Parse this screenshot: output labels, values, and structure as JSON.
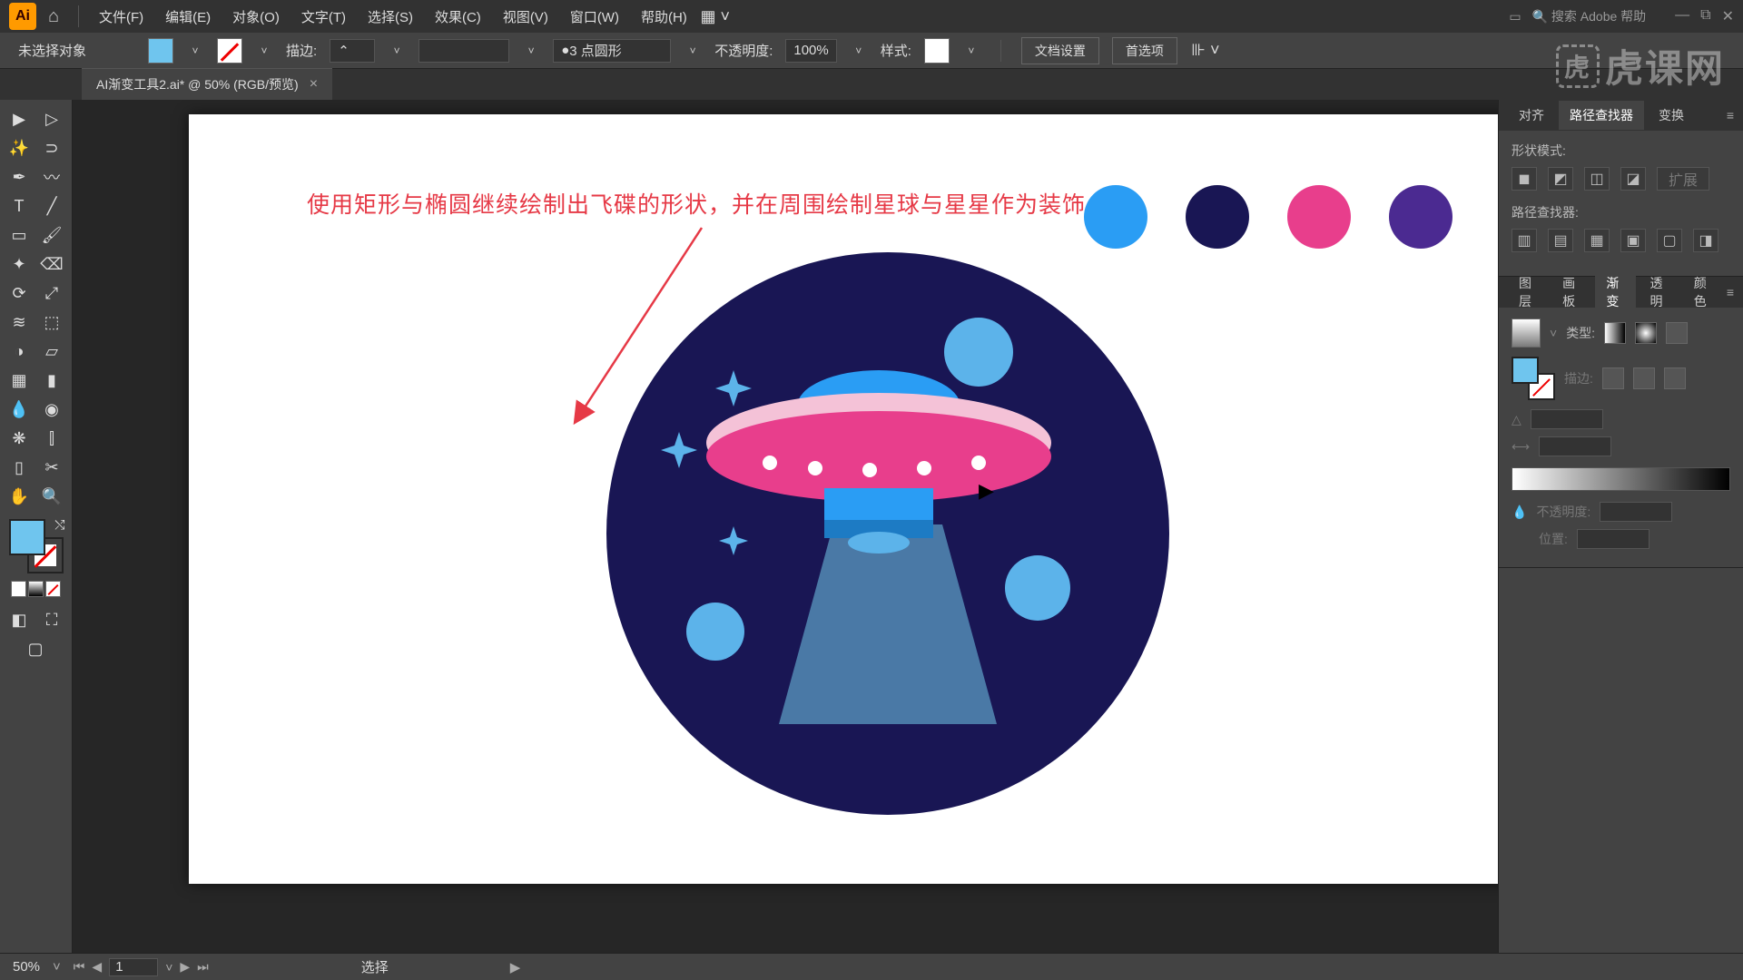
{
  "menubar": {
    "items": [
      "文件(F)",
      "编辑(E)",
      "对象(O)",
      "文字(T)",
      "选择(S)",
      "效果(C)",
      "视图(V)",
      "窗口(W)",
      "帮助(H)"
    ],
    "search_placeholder": "搜索 Adobe 帮助"
  },
  "options": {
    "status_text": "未选择对象",
    "fill_color": "#6fc5ee",
    "stroke_label": "描边:",
    "stroke_profile": "3 点圆形",
    "opacity_label": "不透明度:",
    "opacity_value": "100%",
    "style_label": "样式:",
    "doc_setup_btn": "文档设置",
    "prefs_btn": "首选项"
  },
  "doc_tab": {
    "title": "AI渐变工具2.ai* @ 50% (RGB/预览)"
  },
  "canvas": {
    "annotation": "使用矩形与椭圆继续绘制出飞碟的形状，并在周围绘制星球与星星作为装饰",
    "palette_colors": [
      "#2a9df4",
      "#191654",
      "#e83e8c",
      "#4b2a91"
    ]
  },
  "right_panels": {
    "align_tabs": [
      "对齐",
      "路径查找器",
      "变换"
    ],
    "align_active": 1,
    "shape_mode_label": "形状模式:",
    "expand_label": "扩展",
    "pathfinder_label": "路径查找器:",
    "grad_tabs": [
      "图层",
      "画板",
      "渐变",
      "透明",
      "颜色"
    ],
    "grad_active": 2,
    "grad_type_label": "类型:",
    "grad_stroke_label": "描边:",
    "grad_opacity_label": "不透明度:",
    "grad_location_label": "位置:"
  },
  "statusbar": {
    "zoom": "50%",
    "page": "1",
    "mode": "选择"
  },
  "watermark": "虎课网"
}
